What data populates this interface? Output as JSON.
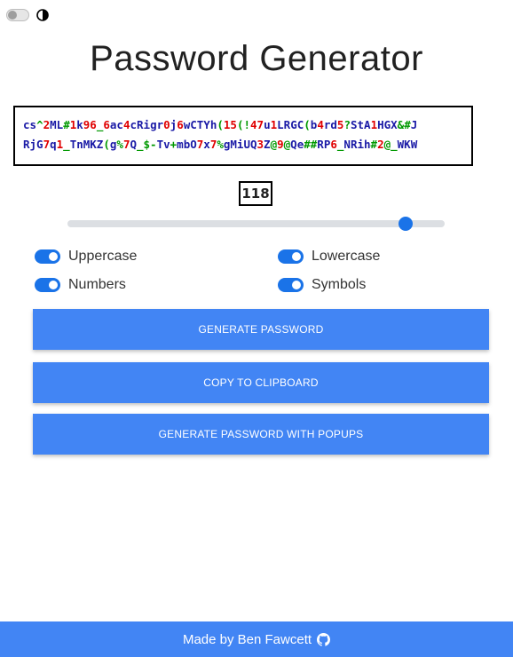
{
  "theme": {
    "toggle_icon": "contrast-icon",
    "theme_switch_on": false
  },
  "title": "Password Generator",
  "password": {
    "line1": [
      [
        "blue",
        "cs"
      ],
      [
        "green",
        "^"
      ],
      [
        "red",
        "2"
      ],
      [
        "blue",
        "ML"
      ],
      [
        "green",
        "#"
      ],
      [
        "red",
        "1"
      ],
      [
        "blue",
        "k"
      ],
      [
        "red",
        "96"
      ],
      [
        "green",
        "_"
      ],
      [
        "red",
        "6"
      ],
      [
        "blue",
        "ac"
      ],
      [
        "red",
        "4"
      ],
      [
        "blue",
        "cRigr"
      ],
      [
        "red",
        "0"
      ],
      [
        "blue",
        "j"
      ],
      [
        "red",
        "6"
      ],
      [
        "blue",
        "wCTYh"
      ],
      [
        "green",
        "("
      ],
      [
        "red",
        "15"
      ],
      [
        "green",
        "(!"
      ],
      [
        "red",
        "47"
      ],
      [
        "blue",
        "u"
      ],
      [
        "red",
        "1"
      ],
      [
        "blue",
        "LRGC"
      ],
      [
        "green",
        "("
      ],
      [
        "blue",
        "b"
      ],
      [
        "red",
        "4"
      ],
      [
        "blue",
        "rd"
      ],
      [
        "red",
        "5"
      ],
      [
        "green",
        "?"
      ],
      [
        "blue",
        "StA"
      ],
      [
        "red",
        "1"
      ],
      [
        "blue",
        "HGX"
      ],
      [
        "green",
        "&#"
      ],
      [
        "blue",
        "J"
      ]
    ],
    "line2": [
      [
        "blue",
        "RjG"
      ],
      [
        "red",
        "7"
      ],
      [
        "blue",
        "q"
      ],
      [
        "red",
        "1"
      ],
      [
        "green",
        "_"
      ],
      [
        "blue",
        "TnMKZ"
      ],
      [
        "green",
        "("
      ],
      [
        "blue",
        "g"
      ],
      [
        "green",
        "%"
      ],
      [
        "red",
        "7"
      ],
      [
        "blue",
        "Q"
      ],
      [
        "green",
        "_$-"
      ],
      [
        "blue",
        "Tv"
      ],
      [
        "green",
        "+"
      ],
      [
        "blue",
        "mbO"
      ],
      [
        "red",
        "7"
      ],
      [
        "blue",
        "x"
      ],
      [
        "red",
        "7"
      ],
      [
        "green",
        "%"
      ],
      [
        "blue",
        "gMiUQ"
      ],
      [
        "red",
        "3"
      ],
      [
        "blue",
        "Z"
      ],
      [
        "green",
        "@"
      ],
      [
        "red",
        "9"
      ],
      [
        "green",
        "@"
      ],
      [
        "blue",
        "Qe"
      ],
      [
        "green",
        "##"
      ],
      [
        "blue",
        "RP"
      ],
      [
        "red",
        "6"
      ],
      [
        "green",
        "_"
      ],
      [
        "blue",
        "NRih"
      ],
      [
        "green",
        "#"
      ],
      [
        "red",
        "2"
      ],
      [
        "green",
        "@_"
      ],
      [
        "blue",
        "WKW"
      ]
    ],
    "colors": {
      "blue": "#1a1aa6",
      "red": "#e00000",
      "green": "#009900"
    }
  },
  "length": {
    "value": "118",
    "slider_fraction": 0.897
  },
  "options": {
    "uppercase": {
      "label": "Uppercase",
      "checked": true
    },
    "lowercase": {
      "label": "Lowercase",
      "checked": true
    },
    "numbers": {
      "label": "Numbers",
      "checked": true
    },
    "symbols": {
      "label": "Symbols",
      "checked": true
    }
  },
  "buttons": {
    "generate": "GENERATE PASSWORD",
    "copy": "COPY TO CLIPBOARD",
    "generate_popups": "GENERATE PASSWORD WITH POPUPS"
  },
  "footer": {
    "text": "Made by Ben Fawcett",
    "icon": "github-icon"
  },
  "accent_color": "#4285f4",
  "switch_color": "#1a73e8"
}
